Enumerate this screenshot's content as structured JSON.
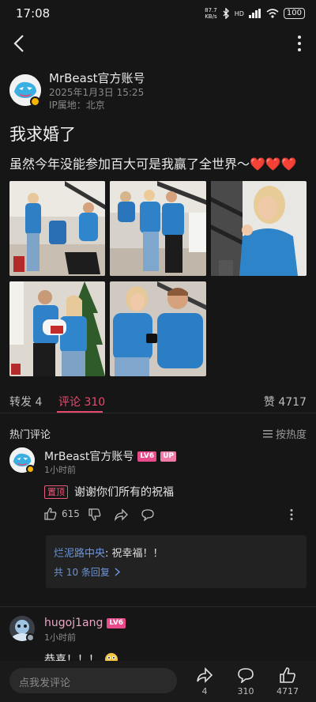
{
  "status_bar": {
    "time": "17:08",
    "speed_value": "87.7",
    "speed_unit": "KB/s",
    "network": "HD",
    "battery": "100"
  },
  "author": {
    "name": "MrBeast官方账号",
    "time": "2025年1月3日 15:25",
    "ip": "IP属地：北京"
  },
  "post": {
    "title": "我求婚了",
    "body": "虽然今年没能参加百大可是我赢了全世界～❤️❤️❤️",
    "photos": [
      "photo-1",
      "photo-2",
      "photo-3",
      "photo-4",
      "photo-5"
    ]
  },
  "tabs": {
    "repost_label": "转发 4",
    "comment_label": "评论 310",
    "like_label": "赞 4717",
    "accent_color": "#e84a6e"
  },
  "comments_header": {
    "title": "热门评论",
    "sort_label": "按热度"
  },
  "comment1": {
    "user": "MrBeast官方账号",
    "level": "LV6",
    "up_badge": "UP",
    "time": "1小时前",
    "pin_label": "置顶",
    "text": "谢谢你们所有的祝福",
    "likes": "615",
    "reply": {
      "user": "烂泥路中央",
      "text": ": 祝幸福！！",
      "more": "共 10 条回复"
    }
  },
  "comment2": {
    "user": "hugoj1ang",
    "level": "LV6",
    "time": "1小时前",
    "text": "恭喜！！！"
  },
  "bottom_bar": {
    "placeholder": "点我发评论",
    "share_count": "4",
    "comment_count": "310",
    "like_count": "4717"
  }
}
